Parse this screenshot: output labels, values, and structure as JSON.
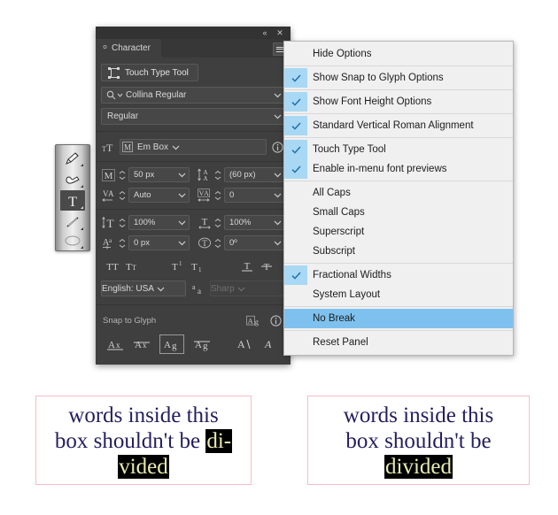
{
  "toolbar": {
    "tools": [
      {
        "name": "pencil-tool",
        "label": "Pencil Tool",
        "selected": false
      },
      {
        "name": "blob-brush-tool",
        "label": "Blob Brush Tool",
        "selected": false
      },
      {
        "name": "type-tool",
        "label": "Type Tool",
        "glyph": "T",
        "selected": true
      },
      {
        "name": "line-segment-tool",
        "label": "Line Segment Tool",
        "selected": false
      },
      {
        "name": "ellipse-tool",
        "label": "Ellipse Tool",
        "selected": false
      }
    ]
  },
  "panel": {
    "tab_label": "Character",
    "collapse_label": "«",
    "close_label": "✕",
    "menu_label": "Panel Menu",
    "touch_type_tool": "Touch Type Tool",
    "font_family": "Collina Regular",
    "font_style": "Regular",
    "em_box": "Em Box",
    "font_size": "50 px",
    "leading": "(60 px)",
    "kerning": "Auto",
    "tracking": "0",
    "vertical_scale": "100%",
    "horizontal_scale": "100%",
    "baseline_shift": "0 px",
    "character_rotation": "0º",
    "language": "English: USA",
    "anti_aliasing": "Sharp",
    "snap_to_glyph_label": "Snap to Glyph",
    "style_buttons": [
      {
        "name": "all-caps-button",
        "glyph": "TT"
      },
      {
        "name": "small-caps-button",
        "glyph": "Tт"
      },
      {
        "name": "superscript-button",
        "glyph": "Tʹ"
      },
      {
        "name": "subscript-button",
        "glyph": "T₁"
      },
      {
        "name": "underline-button",
        "glyph": "T"
      },
      {
        "name": "strikethrough-button",
        "glyph": "T"
      }
    ]
  },
  "flyout_menu": {
    "items": [
      {
        "label": "Hide Options",
        "checked": false,
        "selected": false,
        "divider_after": true
      },
      {
        "label": "Show Snap to Glyph Options",
        "checked": true,
        "selected": false,
        "divider_after": true
      },
      {
        "label": "Show Font Height Options",
        "checked": true,
        "selected": false,
        "divider_after": true
      },
      {
        "label": "Standard Vertical Roman Alignment",
        "checked": true,
        "selected": false,
        "divider_after": true
      },
      {
        "label": "Touch Type Tool",
        "checked": true,
        "selected": false,
        "divider_after": false
      },
      {
        "label": "Enable in-menu font previews",
        "checked": true,
        "selected": false,
        "divider_after": true
      },
      {
        "label": "All Caps",
        "checked": false,
        "selected": false,
        "divider_after": false
      },
      {
        "label": "Small Caps",
        "checked": false,
        "selected": false,
        "divider_after": false
      },
      {
        "label": "Superscript",
        "checked": false,
        "selected": false,
        "divider_after": false
      },
      {
        "label": "Subscript",
        "checked": false,
        "selected": false,
        "divider_after": true
      },
      {
        "label": "Fractional Widths",
        "checked": true,
        "selected": false,
        "divider_after": false
      },
      {
        "label": "System Layout",
        "checked": false,
        "selected": false,
        "divider_after": true
      },
      {
        "label": "No Break",
        "checked": false,
        "selected": true,
        "divider_after": true
      },
      {
        "label": "Reset Panel",
        "checked": false,
        "selected": false,
        "divider_after": false
      }
    ]
  },
  "samples": {
    "left": {
      "line1": "words inside this",
      "line2_plain": "box shouldn't be ",
      "line2_selected": "di-",
      "line3_selected": "vided"
    },
    "right": {
      "line1": "words inside this",
      "line2": "box shouldn't be",
      "line3_selected": "divided"
    }
  },
  "colors": {
    "panel_bg": "#3f3f3f",
    "menu_bg": "#f0f0f0",
    "menu_highlight": "#7fc1ee",
    "check_cell": "#a8d8f4",
    "sample_border": "#f4bfc2",
    "sample_text": "#241e5e",
    "selection_bg": "#000000",
    "selection_text": "#e8ecb0"
  }
}
